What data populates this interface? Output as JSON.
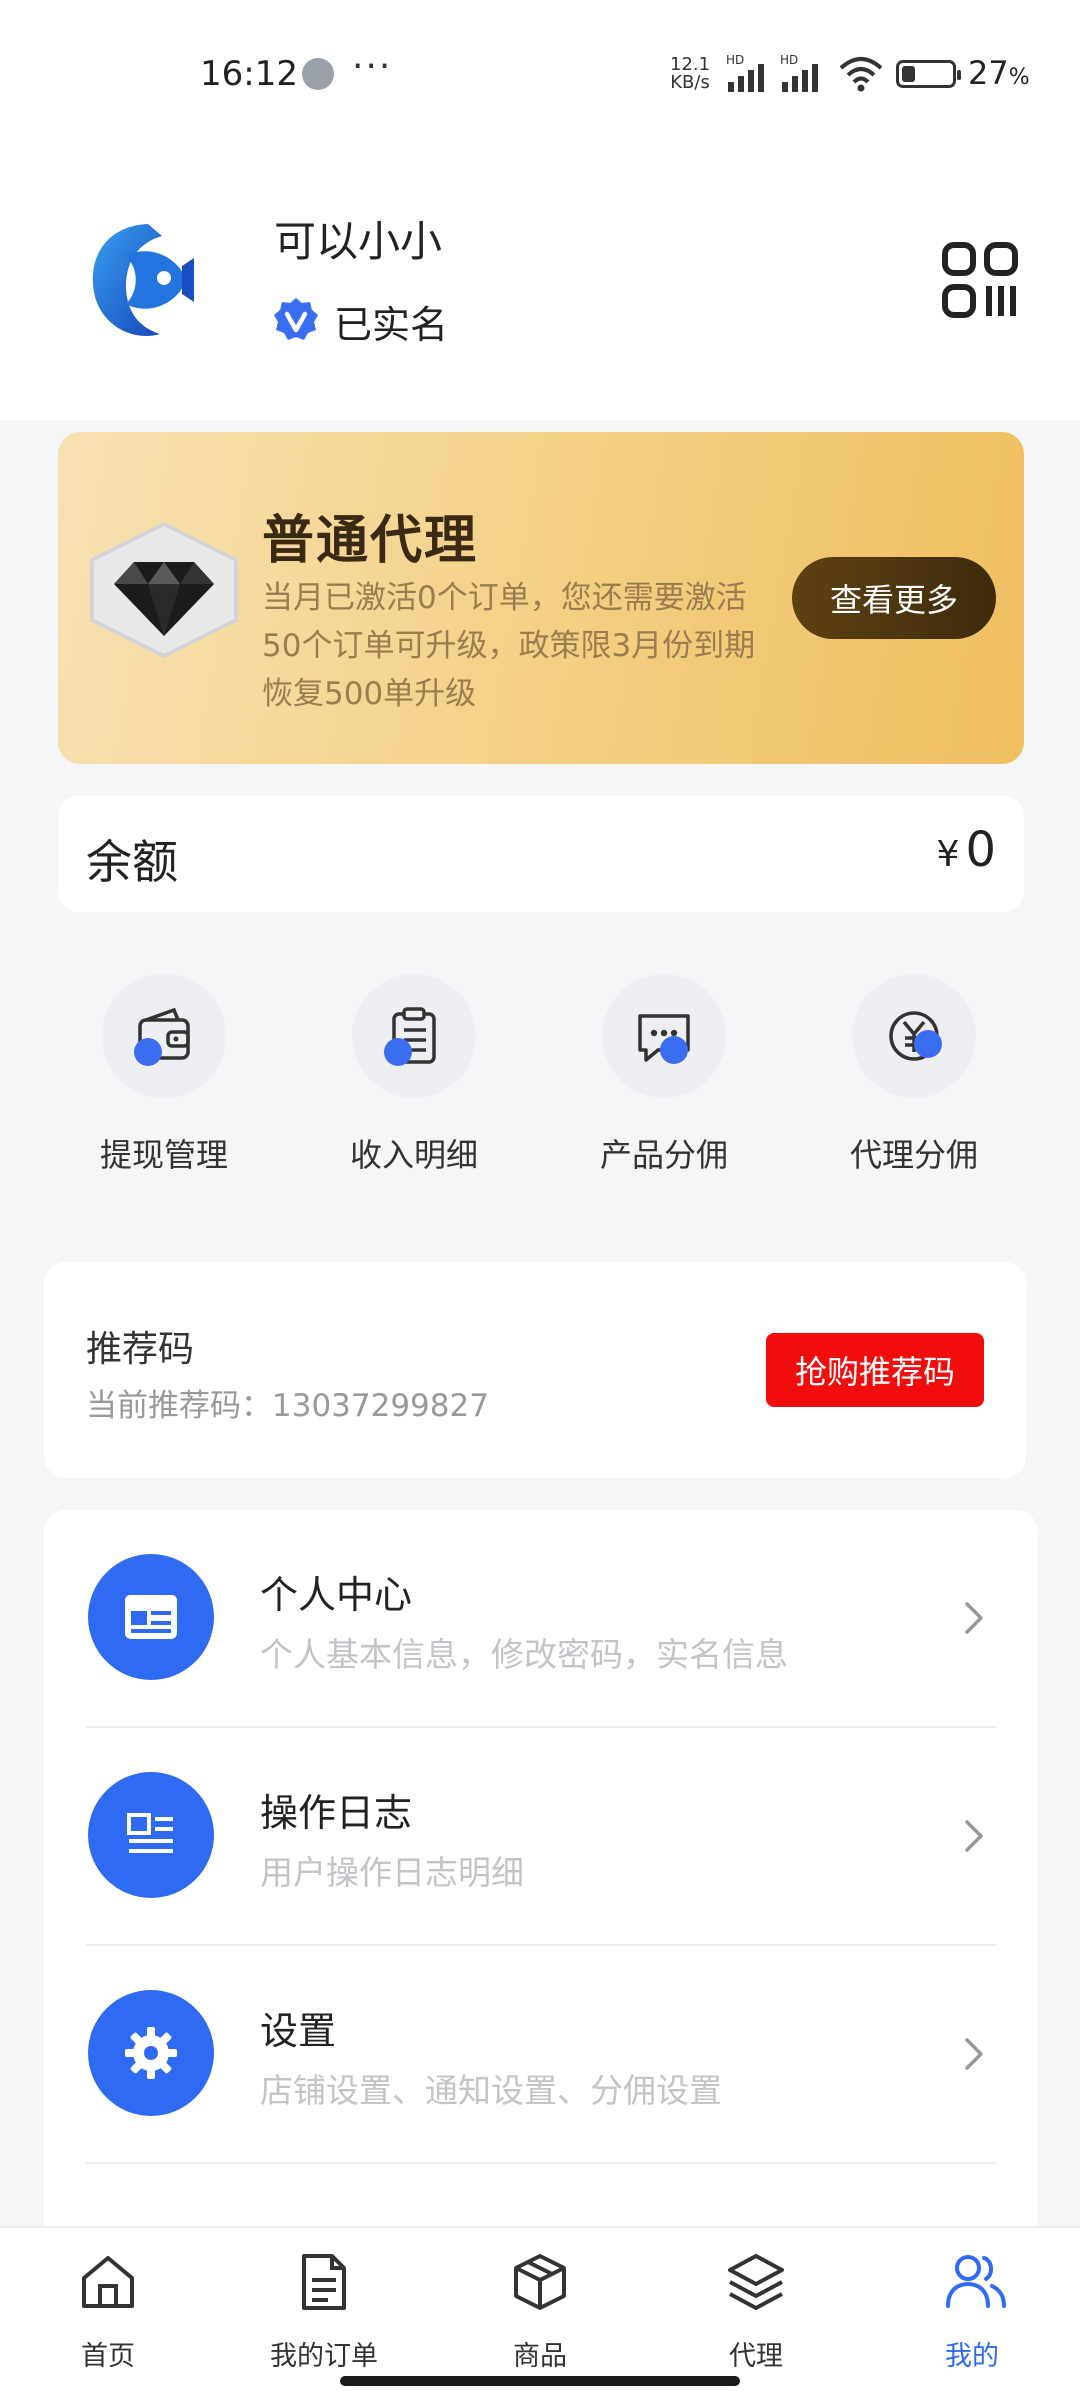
{
  "status_bar": {
    "time": "16:12",
    "dots": "···",
    "speed_value": "12.1",
    "speed_unit": "KB/s",
    "battery_pct": "27",
    "battery_unit": "%",
    "battery_level": 0.27,
    "signal1_label": "HD",
    "signal2_label": "HD"
  },
  "profile": {
    "username": "可以小小",
    "verified_label": "已实名"
  },
  "agent": {
    "title": "普通代理",
    "description": "当月已激活0个订单，您还需要激活50个订单可升级，政策限3月份到期恢复500单升级",
    "more_label": "查看更多"
  },
  "balance": {
    "label": "余额",
    "currency": "¥",
    "value": "0"
  },
  "quick_actions": [
    {
      "label": "提现管理",
      "icon": "wallet-icon"
    },
    {
      "label": "收入明细",
      "icon": "clipboard-icon"
    },
    {
      "label": "产品分佣",
      "icon": "chat-icon"
    },
    {
      "label": "代理分佣",
      "icon": "yen-icon"
    }
  ],
  "referral": {
    "title": "推荐码",
    "current_label": "当前推荐码：",
    "current_value": "13037299827",
    "button_label": "抢购推荐码"
  },
  "menu": [
    {
      "title": "个人中心",
      "subtitle": "个人基本信息，修改密码，实名信息",
      "icon": "id-card-icon"
    },
    {
      "title": "操作日志",
      "subtitle": "用户操作日志明细",
      "icon": "log-icon"
    },
    {
      "title": "设置",
      "subtitle": "店铺设置、通知设置、分佣设置",
      "icon": "gear-icon"
    }
  ],
  "bottom_nav": [
    {
      "label": "首页",
      "icon": "home-icon"
    },
    {
      "label": "我的订单",
      "icon": "orders-icon"
    },
    {
      "label": "商品",
      "icon": "box-icon"
    },
    {
      "label": "代理",
      "icon": "layers-icon"
    },
    {
      "label": "我的",
      "icon": "user-group-icon",
      "active": true
    }
  ],
  "colors": {
    "accent": "#2f6bf2",
    "referral_button": "#f20d0d",
    "gold_start": "#f7e1b2",
    "gold_end": "#f0bf60"
  }
}
